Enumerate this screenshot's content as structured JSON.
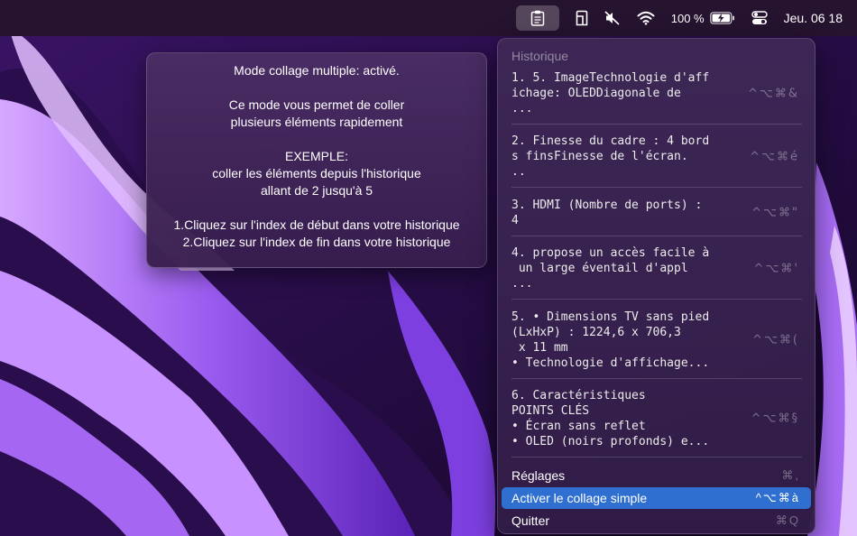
{
  "menubar": {
    "battery_percent": "100 %",
    "battery_level": 1.0,
    "datetime": "Jeu. 06 18",
    "icons": [
      "clipboard-icon",
      "phone-icon",
      "mute-icon",
      "wifi-icon",
      "battery-icon",
      "control-center-icon"
    ]
  },
  "tooltip": {
    "lines": [
      "Mode collage multiple: activé.",
      "",
      "Ce mode vous permet de coller",
      "plusieurs éléments rapidement",
      "",
      "EXEMPLE:",
      "coller les éléments depuis l'historique",
      "allant de 2 jusqu'à 5",
      "",
      "1.Cliquez sur l'index de début dans votre historique",
      "2.Cliquez sur l'index de fin dans votre historique"
    ]
  },
  "menu": {
    "header": "Historique",
    "items": [
      {
        "text": "1. 5. ImageTechnologie d'aff\nichage: OLEDDiagonale de\n...",
        "shortcut": "^⌥⌘&"
      },
      {
        "text": "2. Finesse du cadre : 4 bord\ns finsFinesse de l'écran.\n..",
        "shortcut": "^⌥⌘é"
      },
      {
        "text": "3. HDMI (Nombre de ports) :\n4",
        "shortcut": "^⌥⌘\""
      },
      {
        "text": "4. propose un accès facile à\n un large éventail d'appl\n...",
        "shortcut": "^⌥⌘'"
      },
      {
        "text": "5. • Dimensions TV sans pied\n(LxHxP) : 1224,6 x 706,3\n x 11 mm\n• Technologie d'affichage...",
        "shortcut": "^⌥⌘("
      },
      {
        "text": "6. Caractéristiques\nPOINTS CLÉS\n• Écran sans reflet\n• OLED (noirs profonds) e...",
        "shortcut": "^⌥⌘§"
      }
    ],
    "commands": [
      {
        "label": "Réglages",
        "shortcut": "⌘,"
      },
      {
        "label": "Activer le collage simple",
        "shortcut": "^⌥⌘à"
      },
      {
        "label": "Quitter",
        "shortcut": "⌘Q"
      }
    ]
  },
  "colors": {
    "accent": "#2f6fd0",
    "wallpaper_dark": "#1c0833",
    "wallpaper_light": "#b07cf0"
  }
}
